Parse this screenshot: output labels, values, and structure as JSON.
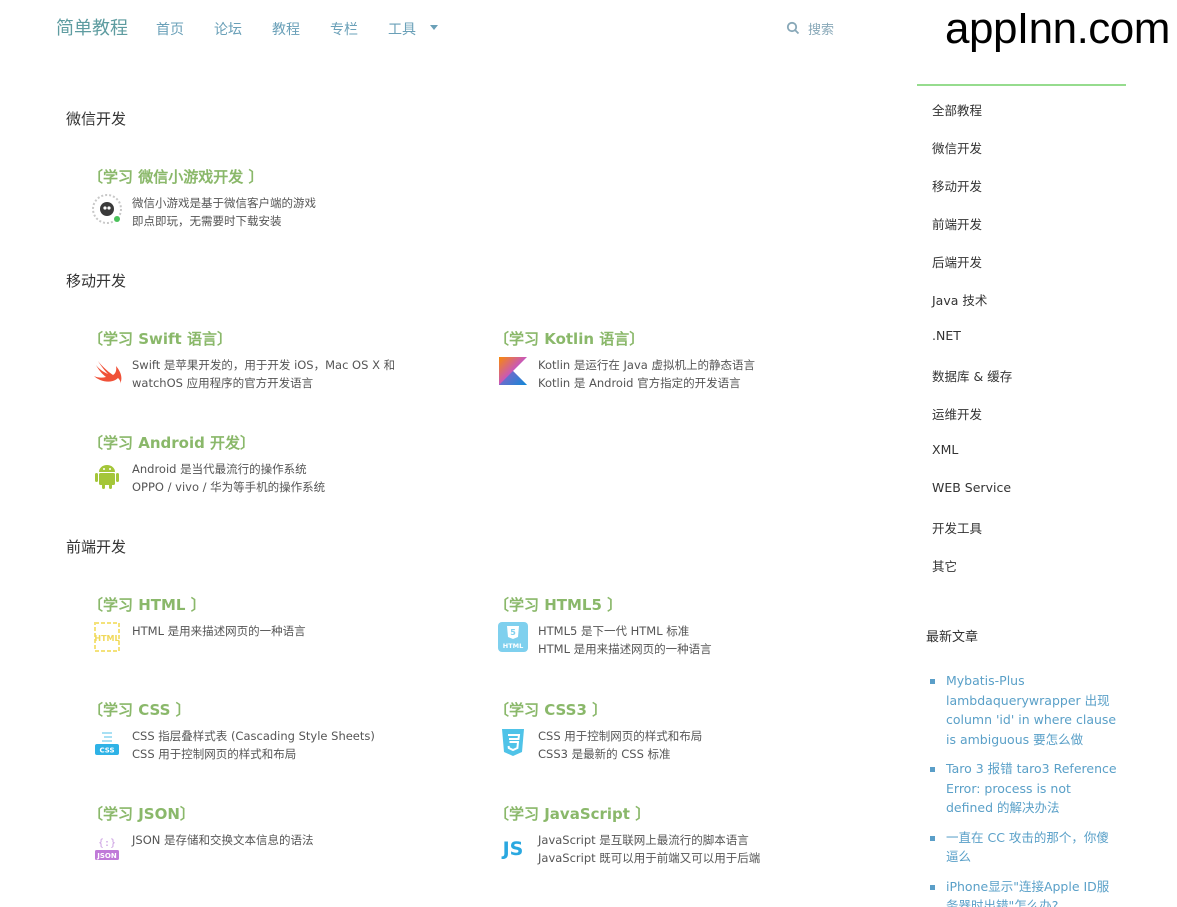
{
  "brand": "简单教程",
  "nav": [
    "首页",
    "论坛",
    "教程",
    "专栏",
    "工具"
  ],
  "search_label": "搜索",
  "watermark": "appInn.com",
  "sections": [
    {
      "title": "微信开发",
      "courses": [
        {
          "title": "〔学习 微信小游戏开发 〕",
          "desc": [
            "微信小游戏是基于微信客户端的游戏",
            "即点即玩，无需要时下载安装"
          ],
          "icon": "wechat-minigame-icon"
        }
      ]
    },
    {
      "title": "移动开发",
      "courses": [
        {
          "title": "〔学习 Swift 语言〕",
          "desc": [
            "Swift 是苹果开发的，用于开发 iOS，Mac OS X 和",
            "watchOS 应用程序的官方开发语言"
          ],
          "icon": "swift-icon"
        },
        {
          "title": "〔学习 Kotlin 语言〕",
          "desc": [
            "Kotlin 是运行在 Java 虚拟机上的静态语言",
            "Kotlin 是 Android 官方指定的开发语言"
          ],
          "icon": "kotlin-icon"
        },
        {
          "title": "〔学习 Android 开发〕",
          "desc": [
            "Android 是当代最流行的操作系统",
            "OPPO / vivo / 华为等手机的操作系统"
          ],
          "icon": "android-icon"
        }
      ]
    },
    {
      "title": "前端开发",
      "courses": [
        {
          "title": "〔学习 HTML 〕",
          "desc": [
            "HTML 是用来描述网页的一种语言"
          ],
          "icon": "html-icon"
        },
        {
          "title": "〔学习 HTML5 〕",
          "desc": [
            "HTML5 是下一代 HTML 标准",
            "HTML 是用来描述网页的一种语言"
          ],
          "icon": "html5-icon"
        },
        {
          "title": "〔学习 CSS 〕",
          "desc": [
            "CSS 指层叠样式表 (Cascading Style Sheets)",
            "CSS 用于控制网页的样式和布局"
          ],
          "icon": "css-icon"
        },
        {
          "title": "〔学习 CSS3 〕",
          "desc": [
            "CSS 用于控制网页的样式和布局",
            "CSS3 是最新的 CSS 标准"
          ],
          "icon": "css3-icon"
        },
        {
          "title": "〔学习 JSON〕",
          "desc": [
            "JSON 是存储和交换文本信息的语法"
          ],
          "icon": "json-icon"
        },
        {
          "title": "〔学习 JavaScript 〕",
          "desc": [
            "JavaScript 是互联网上最流行的脚本语言",
            "JavaScript 既可以用于前端又可以用于后端"
          ],
          "icon": "javascript-icon"
        }
      ]
    }
  ],
  "sidebar": {
    "categories": [
      "全部教程",
      "微信开发",
      "移动开发",
      "前端开发",
      "后端开发",
      "Java 技术",
      ".NET",
      "数据库 & 缓存",
      "运维开发",
      "XML",
      "WEB Service",
      "开发工具",
      "其它"
    ],
    "recent_title": "最新文章",
    "recent": [
      "Mybatis-Plus lambdaquerywrapper 出现 column 'id' in where clause is ambiguous 要怎么做",
      "Taro 3 报错 taro3 Reference Error: process is not defined 的解决办法",
      "一直在 CC 攻击的那个，你傻逼么",
      "iPhone显示\"连接Apple ID服务器时出错\"怎么办?"
    ]
  },
  "colors": {
    "accent": "#8ab86a",
    "link": "#5aa0c8",
    "sidebar_bar": "#96dc8e"
  }
}
